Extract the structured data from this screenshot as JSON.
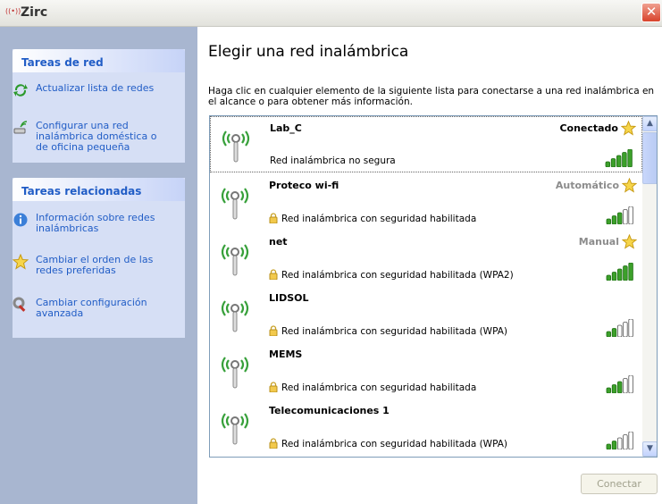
{
  "window": {
    "title": "Zirc"
  },
  "left_pane": {
    "network_tasks": {
      "header": "Tareas de red",
      "items": [
        {
          "icon": "refresh-icon",
          "label": "Actualizar lista de redes"
        },
        {
          "icon": "wireless-setup-icon",
          "label": "Configurar una red inalámbrica doméstica o de oficina pequeña"
        }
      ]
    },
    "related_tasks": {
      "header": "Tareas relacionadas",
      "items": [
        {
          "icon": "info-icon",
          "label": "Información sobre redes inalámbricas"
        },
        {
          "icon": "star-icon",
          "label": "Cambiar el orden de las redes preferidas"
        },
        {
          "icon": "settings-icon",
          "label": "Cambiar configuración avanzada"
        }
      ]
    }
  },
  "main": {
    "heading": "Elegir una red inalámbrica",
    "description": "Haga clic en cualquier elemento de la siguiente lista para conectarse a una red inalámbrica en el alcance o para obtener más información.",
    "networks": [
      {
        "name": "Lab_C",
        "security": "Red inalámbrica no segura",
        "status": "Conectado",
        "secured": false,
        "signal_bars": 5,
        "selected": true
      },
      {
        "name": "Proteco wi-fi",
        "security": "Red inalámbrica con seguridad habilitada",
        "status": "Automático",
        "secured": true,
        "signal_bars": 3,
        "selected": false
      },
      {
        "name": "net",
        "security": "Red inalámbrica con seguridad habilitada (WPA2)",
        "status": "Manual",
        "secured": true,
        "signal_bars": 5,
        "selected": false
      },
      {
        "name": "LIDSOL",
        "security": "Red inalámbrica con seguridad habilitada (WPA)",
        "status": "",
        "secured": true,
        "signal_bars": 2,
        "selected": false
      },
      {
        "name": "MEMS",
        "security": "Red inalámbrica con seguridad habilitada",
        "status": "",
        "secured": true,
        "signal_bars": 3,
        "selected": false
      },
      {
        "name": "Telecomunicaciones 1",
        "security": "Red inalámbrica con seguridad habilitada (WPA)",
        "status": "",
        "secured": true,
        "signal_bars": 2,
        "selected": false
      }
    ],
    "connect_button": "Conectar"
  },
  "colors": {
    "link_blue": "#215dc6",
    "status_connected": "#000000",
    "status_other": "#8c8c8c",
    "signal_on": "#3ca02a",
    "signal_off": "#ffffff"
  }
}
